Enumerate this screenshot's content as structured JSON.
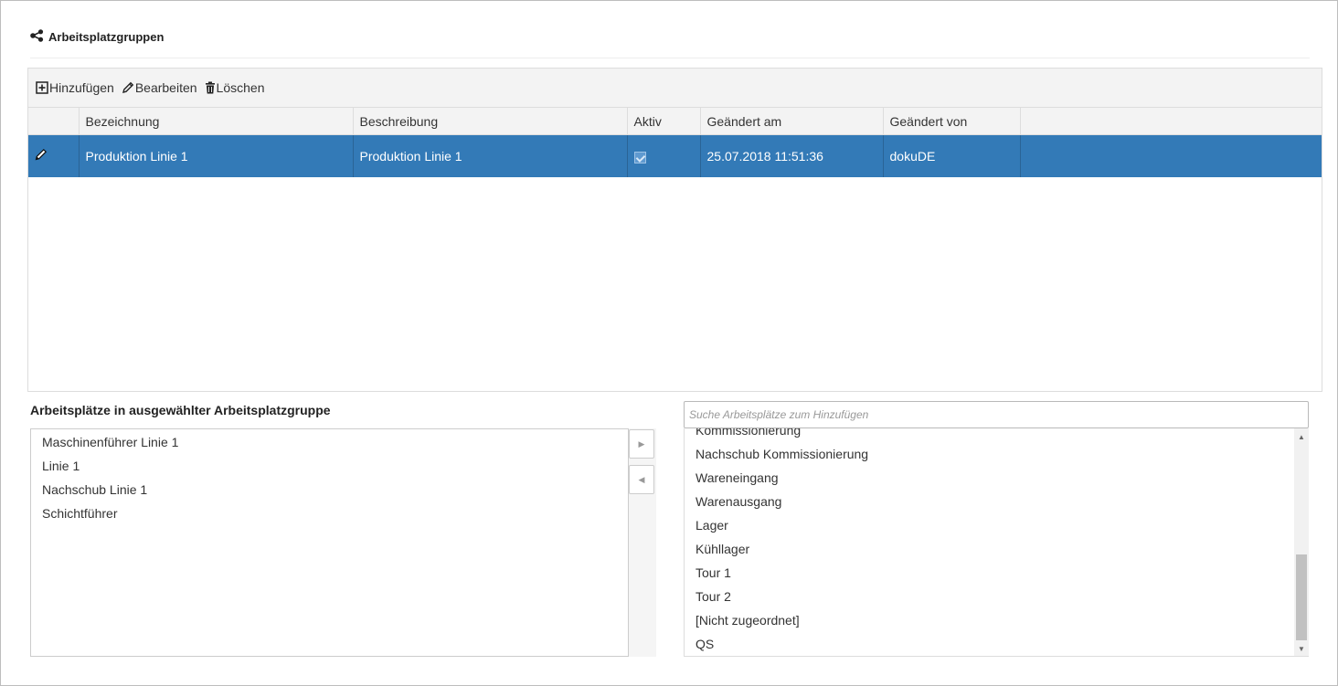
{
  "page": {
    "title": "Arbeitsplatzgruppen",
    "title_icon": "share-icon"
  },
  "toolbar": {
    "add_label": "Hinzufügen",
    "edit_label": "Bearbeiten",
    "delete_label": "Löschen"
  },
  "grid": {
    "columns": [
      "",
      "Bezeichnung",
      "Beschreibung",
      "Aktiv",
      "Geändert am",
      "Geändert von",
      ""
    ],
    "rows": [
      {
        "bezeichnung": "Produktion Linie 1",
        "beschreibung": "Produktion Linie 1",
        "aktiv": true,
        "geaendert_am": "25.07.2018 11:51:36",
        "geaendert_von": "dokuDE"
      }
    ],
    "selected_color": "#337ab7"
  },
  "assigned": {
    "label": "Arbeitsplätze in ausgewählter Arbeitsplatzgruppe",
    "items": [
      "Maschinenführer Linie 1",
      "Linie 1",
      "Nachschub Linie 1",
      "Schichtführer"
    ]
  },
  "available": {
    "placeholder": "Suche Arbeitsplätze zum Hinzufügen",
    "items": [
      "Kommissionierung",
      "Nachschub Kommissionierung",
      "Wareneingang",
      "Warenausgang",
      "Lager",
      "Kühllager",
      "Tour 1",
      "Tour 2",
      "[Nicht zugeordnet]",
      "QS"
    ]
  }
}
